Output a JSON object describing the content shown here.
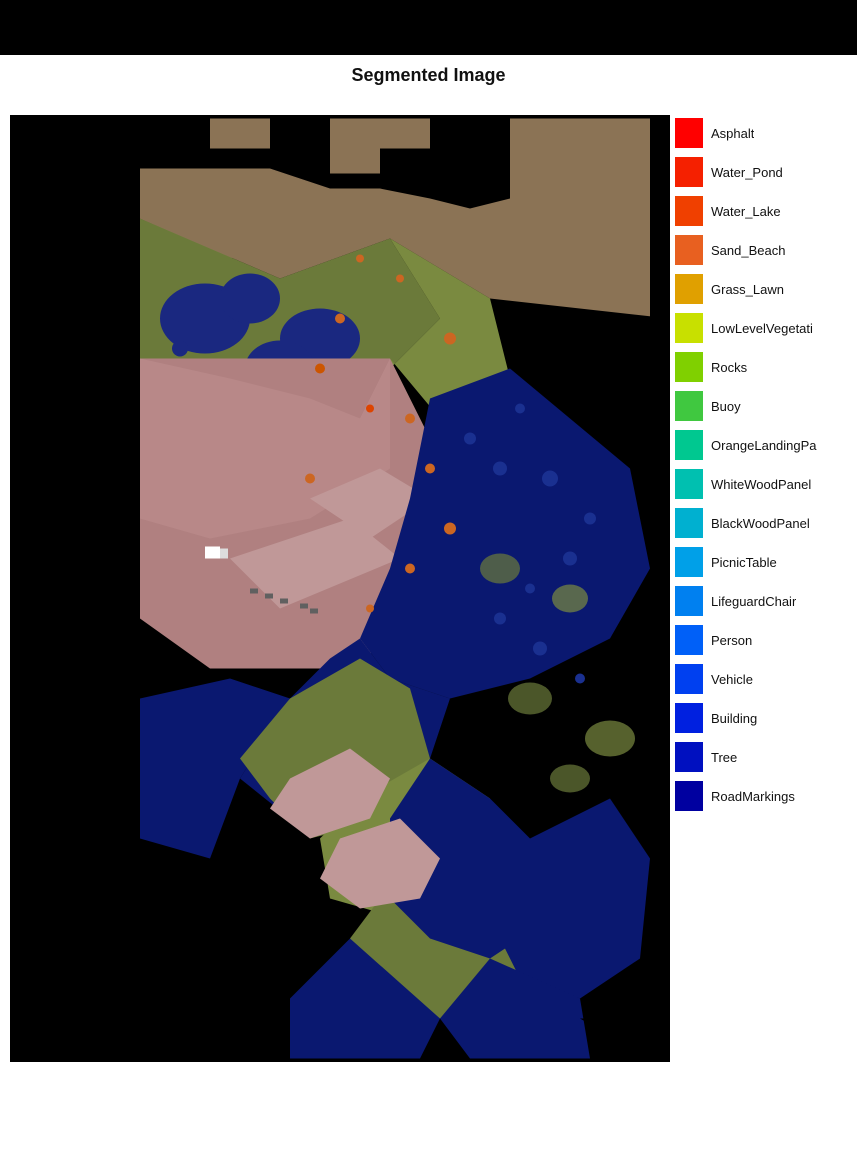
{
  "title": "Segmented Image",
  "legend": {
    "items": [
      {
        "label": "Asphalt",
        "color": "#ff0000"
      },
      {
        "label": "Water_Pond",
        "color": "#f52000"
      },
      {
        "label": "Water_Lake",
        "color": "#f04000"
      },
      {
        "label": "Sand_Beach",
        "color": "#e86020"
      },
      {
        "label": "Grass_Lawn",
        "color": "#e0a000"
      },
      {
        "label": "LowLevelVegetati",
        "color": "#c8e000"
      },
      {
        "label": "Rocks",
        "color": "#80d000"
      },
      {
        "label": "Buoy",
        "color": "#40c840"
      },
      {
        "label": "OrangeLandingPa",
        "color": "#00c890"
      },
      {
        "label": "WhiteWoodPanel",
        "color": "#00c0b0"
      },
      {
        "label": "BlackWoodPanel",
        "color": "#00b0d0"
      },
      {
        "label": "PicnicTable",
        "color": "#00a0e8"
      },
      {
        "label": "LifeguardChair",
        "color": "#0080f0"
      },
      {
        "label": "Person",
        "color": "#0060f8"
      },
      {
        "label": "Vehicle",
        "color": "#0040f0"
      },
      {
        "label": "Building",
        "color": "#0020e0"
      },
      {
        "label": "Tree",
        "color": "#0010c0"
      },
      {
        "label": "RoadMarkings",
        "color": "#0000a0"
      }
    ]
  }
}
